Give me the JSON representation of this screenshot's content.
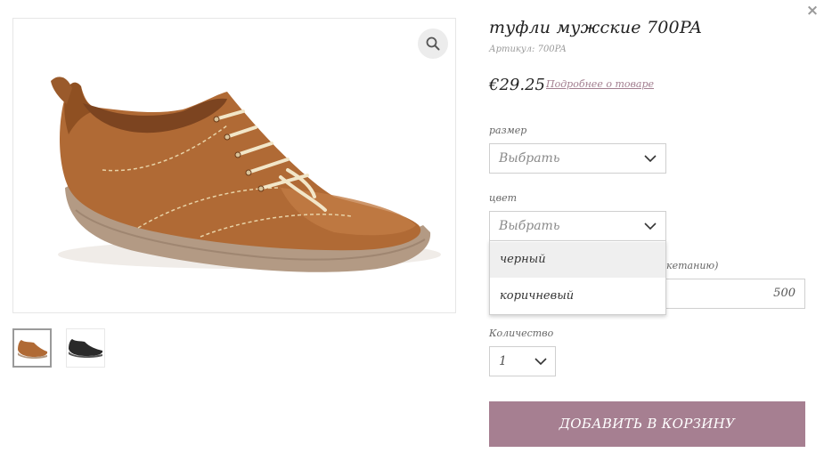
{
  "modal": {
    "close_label": "×"
  },
  "product": {
    "title": "туфли мужские 700PA",
    "sku": "Артикул: 700PA",
    "price": "€29.25",
    "details_link": "Подробнее о товаре"
  },
  "gallery": {
    "main_image": "brown-leather-shoe",
    "zoom_icon": "search-icon",
    "thumbnails": [
      {
        "image": "brown-leather-shoe",
        "selected": true
      },
      {
        "image": "black-leather-shoe",
        "selected": false
      }
    ]
  },
  "options": {
    "size": {
      "label": "размер",
      "value": "Выбрать"
    },
    "color": {
      "label": "цвет",
      "value": "Выбрать",
      "open": true,
      "options": [
        "черный",
        "коричневый"
      ]
    },
    "length": {
      "label_fragment": "кетанию)",
      "value": "500"
    },
    "quantity": {
      "label": "Количество",
      "value": "1"
    }
  },
  "cart": {
    "add_label": "ДОБАВИТЬ В КОРЗИНУ"
  },
  "colors": {
    "accent": "#a67f91",
    "shoe_brown": "#b06a35",
    "sole": "#b39a84"
  }
}
